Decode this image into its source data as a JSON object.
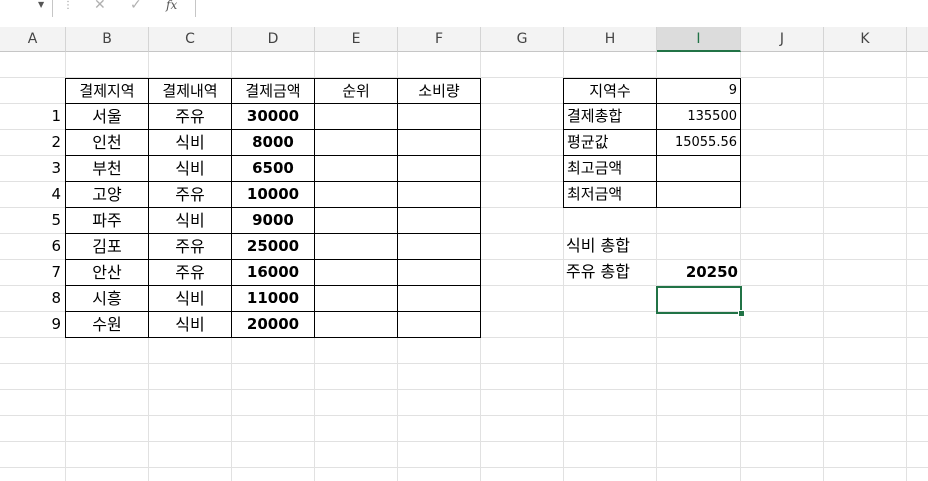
{
  "formula_bar": {
    "fx_label": "fx",
    "cancel_glyph": "✕",
    "enter_glyph": "✓",
    "value": ""
  },
  "columns": [
    "A",
    "B",
    "C",
    "D",
    "E",
    "F",
    "G",
    "H",
    "I",
    "J",
    "K"
  ],
  "selected_column": "I",
  "table": {
    "headers": [
      "결제지역",
      "결제내역",
      "결제금액",
      "순위",
      "소비량"
    ],
    "rows": [
      {
        "num": "1",
        "region": "서울",
        "item": "주유",
        "amount": "30000",
        "rank": "",
        "usage": ""
      },
      {
        "num": "2",
        "region": "인천",
        "item": "식비",
        "amount": "8000",
        "rank": "",
        "usage": ""
      },
      {
        "num": "3",
        "region": "부천",
        "item": "식비",
        "amount": "6500",
        "rank": "",
        "usage": ""
      },
      {
        "num": "4",
        "region": "고양",
        "item": "주유",
        "amount": "10000",
        "rank": "",
        "usage": ""
      },
      {
        "num": "5",
        "region": "파주",
        "item": "식비",
        "amount": "9000",
        "rank": "",
        "usage": ""
      },
      {
        "num": "6",
        "region": "김포",
        "item": "주유",
        "amount": "25000",
        "rank": "",
        "usage": ""
      },
      {
        "num": "7",
        "region": "안산",
        "item": "주유",
        "amount": "16000",
        "rank": "",
        "usage": ""
      },
      {
        "num": "8",
        "region": "시흥",
        "item": "식비",
        "amount": "11000",
        "rank": "",
        "usage": ""
      },
      {
        "num": "9",
        "region": "수원",
        "item": "식비",
        "amount": "20000",
        "rank": "",
        "usage": ""
      }
    ]
  },
  "summary": {
    "rows": [
      {
        "label": "지역수",
        "value": "9"
      },
      {
        "label": "결제총합",
        "value": "135500"
      },
      {
        "label": "평균값",
        "value": "15055.56"
      },
      {
        "label": "최고금액",
        "value": ""
      },
      {
        "label": "최저금액",
        "value": ""
      }
    ],
    "food_total_label": "식비 총합",
    "food_total_value": "",
    "fuel_total_label": "주유 총합",
    "fuel_total_value": "20250"
  }
}
